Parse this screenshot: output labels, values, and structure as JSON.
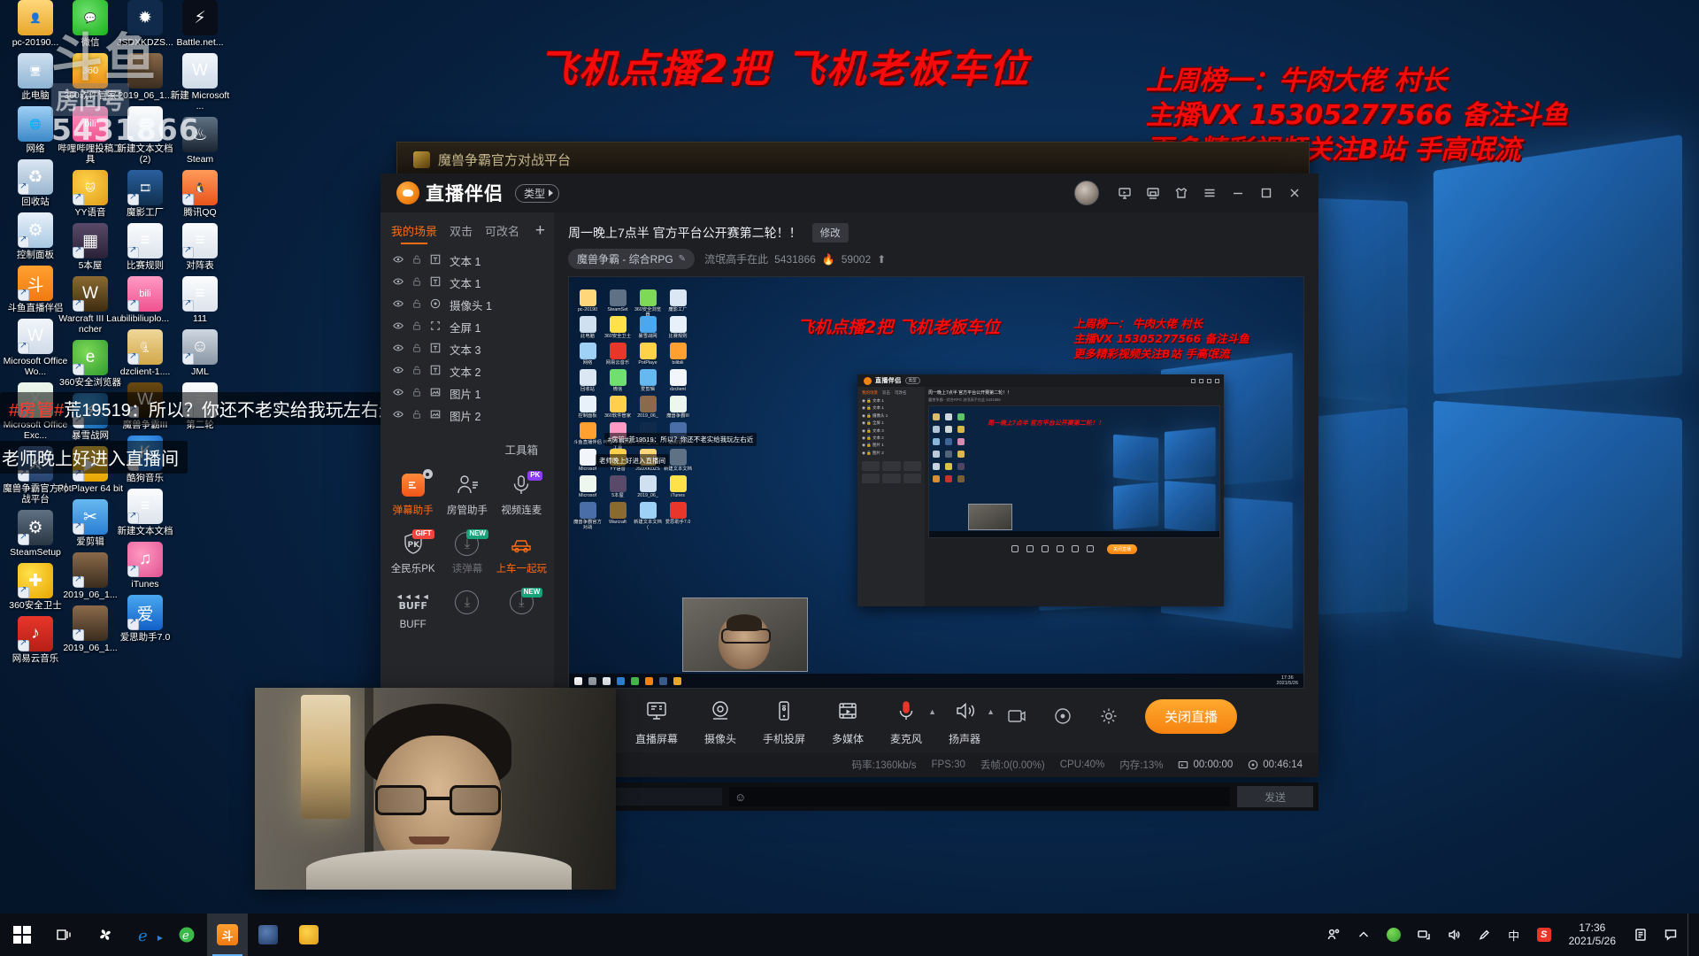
{
  "desktop": {
    "watermark": {
      "line1": "斗鱼",
      "line2": "房间号",
      "line3": "5431866"
    },
    "icons_col1": [
      {
        "label": "pc-20190...",
        "kind": "folder-user"
      },
      {
        "label": "此电脑",
        "kind": "computer"
      },
      {
        "label": "网络",
        "kind": "network"
      },
      {
        "label": "回收站",
        "kind": "recycle"
      },
      {
        "label": "控制面板",
        "kind": "control-panel"
      },
      {
        "label": "斗鱼直播伴侣",
        "kind": "douyu"
      },
      {
        "label": "Microsoft Office Wo...",
        "kind": "word"
      },
      {
        "label": "Microsoft Office Exc...",
        "kind": "excel"
      },
      {
        "label": "魔兽争霸官方对战平台",
        "kind": "wc3-platform"
      },
      {
        "label": "SteamSetup",
        "kind": "steam-setup"
      },
      {
        "label": "360安全卫士",
        "kind": "360-guard"
      },
      {
        "label": "网易云音乐",
        "kind": "netease-music"
      }
    ],
    "icons_col2": [
      {
        "label": "微信",
        "kind": "wechat"
      },
      {
        "label": "360软件管家",
        "kind": "360-soft"
      },
      {
        "label": "哔哩哔哩投稿工具",
        "kind": "bilibili-upload"
      },
      {
        "label": "YY语音",
        "kind": "yy-voice"
      },
      {
        "label": "5本屋",
        "kind": "5benwu"
      },
      {
        "label": "Warcraft III Launcher",
        "kind": "warcraft3"
      },
      {
        "label": "360安全浏览器",
        "kind": "360-browser"
      },
      {
        "label": "暴雪战网",
        "kind": "battlenet"
      },
      {
        "label": "PotPlayer 64 bit",
        "kind": "potplayer"
      },
      {
        "label": "爱剪辑",
        "kind": "aijianji"
      },
      {
        "label": "2019_06_1...",
        "kind": "photo"
      },
      {
        "label": "2019_06_1...",
        "kind": "photo"
      }
    ],
    "icons_col3": [
      {
        "label": "JSDXKDZS...",
        "kind": "blue-burst"
      },
      {
        "label": "2019_06_1...",
        "kind": "photo"
      },
      {
        "label": "新建文本文档 (2)",
        "kind": "textfile"
      },
      {
        "label": "魔影工厂",
        "kind": "moying"
      },
      {
        "label": "比赛规则",
        "kind": "textfile"
      },
      {
        "label": "bilibiliuplo...",
        "kind": "bilibili-upload"
      },
      {
        "label": "dzclient-1....",
        "kind": "zip"
      },
      {
        "label": "魔兽争霸III",
        "kind": "warcraft3-w"
      },
      {
        "label": "酷狗音乐",
        "kind": "kugou"
      },
      {
        "label": "新建文本文档",
        "kind": "textfile"
      },
      {
        "label": "iTunes",
        "kind": "itunes"
      },
      {
        "label": "爱思助手7.0",
        "kind": "aisi"
      }
    ],
    "icons_col4": [
      {
        "label": "Battle.net...",
        "kind": "battlenet-dark"
      },
      {
        "label": "新建 Microsoft ...",
        "kind": "word-doc"
      },
      {
        "label": "Steam",
        "kind": "steam"
      },
      {
        "label": "腾讯QQ",
        "kind": "qq"
      },
      {
        "label": "对阵表",
        "kind": "textfile"
      },
      {
        "label": "111",
        "kind": "textfile"
      },
      {
        "label": "JML",
        "kind": "avatar-file"
      },
      {
        "label": "第二轮",
        "kind": "textfile"
      }
    ]
  },
  "overlay": {
    "title": "飞机点播2把  飞机老板车位",
    "right_lines": [
      "上周榜一：牛肉大佬 村长",
      "主播VX   15305277566  备注斗鱼",
      "更多精彩视频关注B站  手高氓流"
    ],
    "danmaku": [
      {
        "prefix": "#房管#",
        "text": "荒19519：所以？你还不老实给我玩左右近"
      },
      {
        "prefix": "",
        "text": "老师晚上好进入直播间"
      }
    ]
  },
  "wc3_window": {
    "title": "魔兽争霸官方对战平台"
  },
  "app": {
    "brand": "直播伴侣",
    "type_button": "类型",
    "titlebar_icons": [
      "screen-share-icon",
      "save-icon",
      "shirt-icon",
      "menu-icon",
      "minimize-icon",
      "maximize-icon",
      "close-icon"
    ],
    "toolbar_icons": [
      "task-list-icon",
      "unlock-icon",
      "layout-icon",
      "bell-icon",
      "share-icon"
    ],
    "scene_tabs": [
      {
        "label": "我的场景",
        "active": true
      },
      {
        "label": "双击",
        "active": false
      },
      {
        "label": "可改名",
        "active": false
      }
    ],
    "add_scene": "+",
    "sources": [
      {
        "name": "文本 1",
        "icon": "text-icon"
      },
      {
        "name": "文本 1",
        "icon": "text-icon"
      },
      {
        "name": "摄像头 1",
        "icon": "camera-icon"
      },
      {
        "name": "全屏 1",
        "icon": "fullscreen-icon"
      },
      {
        "name": "文本 3",
        "icon": "text-icon"
      },
      {
        "name": "文本 2",
        "icon": "text-icon"
      },
      {
        "name": "图片 1",
        "icon": "image-icon"
      },
      {
        "name": "图片 2",
        "icon": "image-icon"
      }
    ],
    "toolbox_header": "工具箱",
    "tools": [
      {
        "label": "弹幕助手",
        "icon": "danmaku-icon",
        "state": "hot",
        "badge": "",
        "gear": true
      },
      {
        "label": "房管助手",
        "icon": "moderator-icon",
        "state": "normal",
        "badge": ""
      },
      {
        "label": "视频连麦",
        "icon": "video-mic-icon",
        "state": "normal",
        "badge": "PK",
        "badge_kind": "pk"
      },
      {
        "label": "全民乐PK",
        "icon": "pk-shield-icon",
        "state": "normal",
        "badge": "GIFT",
        "badge_kind": "gift"
      },
      {
        "label": "读弹幕",
        "icon": "download-icon",
        "state": "off",
        "badge": "NEW",
        "badge_kind": "new"
      },
      {
        "label": "上车一起玩",
        "icon": "car-icon",
        "state": "hot",
        "badge": ""
      },
      {
        "label": "BUFF",
        "icon": "buff-icon",
        "state": "normal",
        "badge": ""
      },
      {
        "label": "",
        "icon": "download-icon",
        "state": "off",
        "badge": ""
      },
      {
        "label": "",
        "icon": "download-icon",
        "state": "off",
        "badge": "NEW",
        "badge_kind": "new"
      }
    ],
    "stream": {
      "title": "周一晚上7点半 官方平台公开赛第二轮！！",
      "edit_label": "修改",
      "category": "魔兽争霸 - 综合RPG",
      "room_name": "流氓高手在此",
      "room_id": "5431866",
      "hot_value": "59002"
    },
    "controls": [
      {
        "label": "直播屏幕",
        "icon": "monitor-icon",
        "caret": false
      },
      {
        "label": "摄像头",
        "icon": "webcam-icon",
        "caret": false
      },
      {
        "label": "手机投屏",
        "icon": "phone-cast-icon",
        "caret": false
      },
      {
        "label": "多媒体",
        "icon": "media-icon",
        "caret": false
      },
      {
        "label": "麦克风",
        "icon": "microphone-icon",
        "caret": true
      },
      {
        "label": "扬声器",
        "icon": "speaker-icon",
        "caret": true
      }
    ],
    "control_extras": [
      "record-icon",
      "preview-eye-icon",
      "settings-gear-icon"
    ],
    "stop_button": "关闭直播",
    "status": {
      "bitrate": "码率:1360kb/s",
      "fps": "FPS:30",
      "dropped": "丢帧:0(0.00%)",
      "cpu": "CPU:40%",
      "memory": "内存:13%",
      "record_time": "00:00:00",
      "live_time": "00:46:14"
    },
    "preview": {
      "red_title": "飞机点播2把 飞机老板车位",
      "red_lines": [
        "上周榜一：  牛肉大佬 村长",
        "主播VX   15305277566  备注斗鱼",
        "更多精彩视频关注B站  手高氓流"
      ],
      "danmaku": [
        "#房管#荒19519：所以？你还不老实给我玩左右近",
        "老师晚上好进入直播间"
      ],
      "nested": {
        "brand": "直播伴侣",
        "type_button": "类型",
        "tabs": [
          "我的场景",
          "双击",
          "可改名"
        ],
        "sources": [
          "文本 1",
          "文本 1",
          "摄像头 1",
          "全屏 1",
          "文本 3",
          "文本 2",
          "图片 1",
          "图片 2"
        ],
        "title": "周一晚上7点半 官方平台公开赛第二轮！！",
        "meta": "魔兽争霸 - 综合RPG   流氓高手在此  5431866",
        "stop_button": "关闭直播"
      },
      "taskbar_clock": {
        "time": "17:36",
        "date": "2021/5/26"
      }
    }
  },
  "chat": {
    "emoji_icon": "smiley-icon",
    "send_label": "发送",
    "input_placeholder": ""
  },
  "taskbar": {
    "start_icon": "windows-start-icon",
    "items": [
      {
        "name": "task-view",
        "icon": "task-view-icon"
      },
      {
        "name": "cortana-fan",
        "icon": "fan-icon"
      },
      {
        "name": "internet-explorer",
        "icon": "ie-icon"
      },
      {
        "name": "360-browser",
        "icon": "360-browser-icon"
      },
      {
        "name": "douyu-companion",
        "icon": "douyu-icon",
        "active": true
      },
      {
        "name": "wc3-platform",
        "icon": "wc3-icon"
      },
      {
        "name": "yy-voice",
        "icon": "yy-cat-icon"
      }
    ],
    "tray": [
      "people-icon",
      "chevron-up-icon",
      "360-shield-icon",
      "network-icon",
      "volume-icon",
      "pen-icon",
      "ime-cn-icon",
      "sogou-icon"
    ],
    "clock": {
      "time": "17:36",
      "date": "2021/5/26"
    },
    "right_icons": [
      "notes-icon",
      "action-center-icon"
    ]
  }
}
